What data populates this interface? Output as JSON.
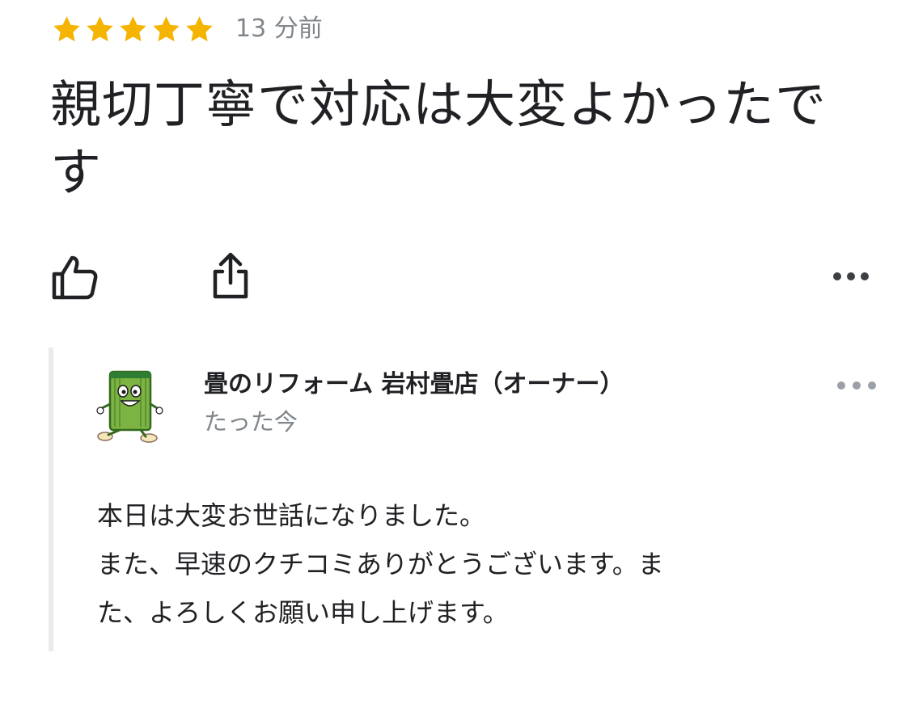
{
  "review": {
    "rating": 5,
    "max_rating": 5,
    "star_color": "#f4b400",
    "time_ago": "13 分前",
    "text": "親切丁寧で対応は大変よかったです"
  },
  "actions": {
    "like_icon": "thumbs-up-icon",
    "share_icon": "share-icon",
    "more_icon": "more-horizontal-icon"
  },
  "owner_reply": {
    "name": "畳のリフォーム 岩村畳店（オーナー）",
    "time": "たった今",
    "avatar_icon": "tatami-mascot-avatar",
    "body_lines": [
      "本日は大変お世話になりました。",
      "また、早速のクチコミありがとうございます。ま",
      "た、よろしくお願い申し上げます。"
    ]
  }
}
